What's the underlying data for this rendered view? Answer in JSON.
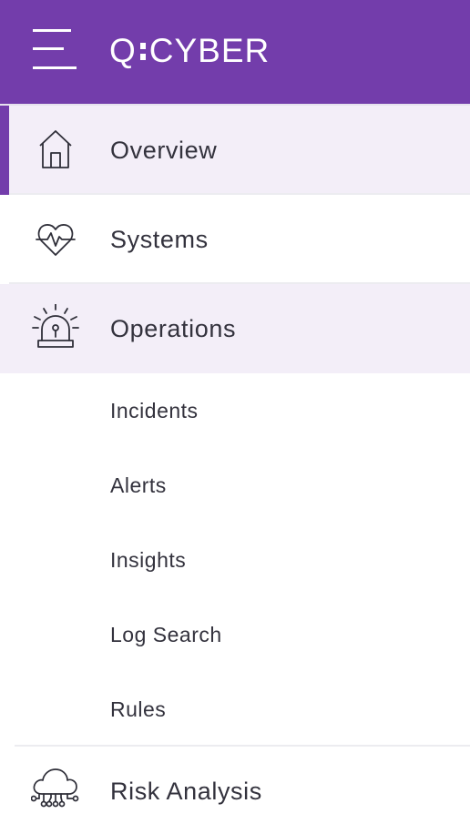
{
  "theme": {
    "brand_color": "#733dab",
    "active_background": "#f3eef8",
    "text_color": "#33323d"
  },
  "header": {
    "menu_icon": "hamburger-menu-icon",
    "logo_left": "Q",
    "logo_right": "CYBER"
  },
  "nav": {
    "overview": {
      "label": "Overview",
      "icon": "home-icon",
      "selected": true
    },
    "systems": {
      "label": "Systems",
      "icon": "heart-pulse-icon"
    },
    "operations": {
      "label": "Operations",
      "icon": "alarm-siren-icon",
      "expanded": true,
      "children": [
        "Incidents",
        "Alerts",
        "Insights",
        "Log Search",
        "Rules"
      ]
    },
    "risk_analysis": {
      "label": "Risk Analysis",
      "icon": "cloud-network-icon"
    }
  }
}
